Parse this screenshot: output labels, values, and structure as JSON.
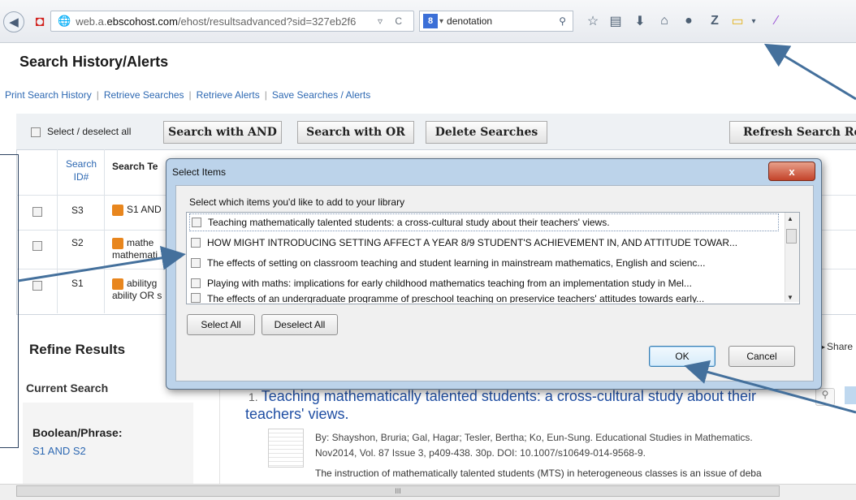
{
  "browser": {
    "url_prefix": "web.a.",
    "url_host": "ebscohost.com",
    "url_path": "/ehost/resultsadvanced?sid=327eb2f6",
    "url_tail_icons": "▿ C",
    "search_engine_badge": "8",
    "search_query": "denotation",
    "icons": [
      "back-icon",
      "bookmark-star-icon",
      "reading-list-icon",
      "download-icon",
      "home-icon",
      "chat-icon",
      "zotero-icon",
      "folder-icon",
      "dropdown-icon",
      "feather-icon"
    ]
  },
  "page": {
    "title": "Search History/Alerts",
    "links": [
      "Print Search History",
      "Retrieve Searches",
      "Retrieve Alerts",
      "Save Searches / Alerts"
    ]
  },
  "history": {
    "select_all_label": "Select / deselect all",
    "buttons": [
      "Search with AND",
      "Search with OR",
      "Delete Searches",
      "Refresh Search Re"
    ],
    "col_search_id": "Search ID#",
    "col_search_terms": "Search Te",
    "rows": [
      {
        "id": "S3",
        "terms_line1": "S1 AND",
        "terms_line2": ""
      },
      {
        "id": "S2",
        "terms_line1": "mathe",
        "terms_line2": "mathemati"
      },
      {
        "id": "S1",
        "terms_line1": "abilityg",
        "terms_line2": "ability OR s"
      }
    ]
  },
  "dialog": {
    "title": "Select Items",
    "close_label": "x",
    "prompt": "Select which items you'd like to add to your library",
    "items": [
      "Teaching mathematically talented students: a cross-cultural study about their teachers' views.",
      "HOW MIGHT INTRODUCING SETTING AFFECT A YEAR 8/9 STUDENT'S ACHIEVEMENT IN, AND ATTITUDE TOWAR...",
      "The effects of setting on classroom teaching and student learning in mainstream mathematics, English and scienc...",
      "Playing with maths: implications for early childhood mathematics teaching from an implementation study in Mel...",
      "The effects of an undergraduate programme of preschool teaching on preservice teachers' attitudes towards early..."
    ],
    "select_all": "Select All",
    "deselect_all": "Deselect All",
    "ok": "OK",
    "cancel": "Cancel"
  },
  "refine": {
    "title": "Refine Results",
    "current_search": "Current Search",
    "boolean_label": "Boolean/Phrase:",
    "boolean_value": "S1 AND S2",
    "share": "Share"
  },
  "result": {
    "number": "1.",
    "title": "Teaching mathematically talented students: a cross-cultural study about their teachers' views.",
    "byline_1": "By: Shayshon, Bruria; Gal, Hagar; Tesler, Bertha; Ko, Eun-Sung. Educational Studies in Mathematics.",
    "byline_2": "Nov2014, Vol. 87 Issue 3, p409-438. 30p. DOI: 10.1007/s10649-014-9568-9.",
    "abstract": "The instruction of mathematically talented students (MTS) in heterogeneous classes is an issue of deba"
  },
  "scrollbar_label": "III",
  "colors": {
    "link": "#2d68b2",
    "accent_title": "#1f4ea3",
    "annotation_arrow": "#44709c"
  }
}
